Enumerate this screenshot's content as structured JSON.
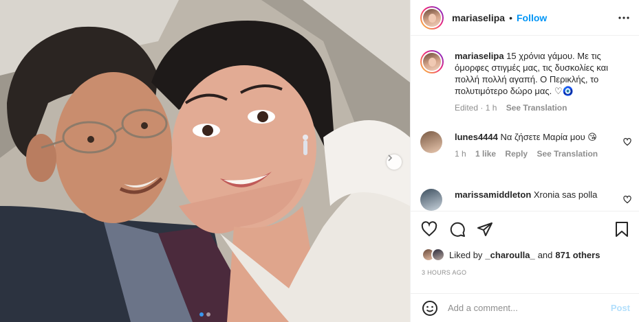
{
  "post": {
    "username": "mariaselipa",
    "separator": "•",
    "follow_label": "Follow",
    "more_icon": "more-horizontal-icon",
    "caption": "15 χρόνια γάμου. Με τις όμορφες στιγμές μας, τις δυσκολίες και πολλή πολλή αγαπή. Ο Περικλής, το πολυτιμότερο δώρο μας. ♡🧿",
    "caption_edited": "Edited",
    "caption_age": "1 h",
    "see_translation": "See Translation"
  },
  "comments": [
    {
      "username": "lunes4444",
      "text": "Να ζήσετε Μαρία μου 😘",
      "age": "1 h",
      "likes": "1 like",
      "reply": "Reply",
      "see_translation": "See Translation"
    },
    {
      "username": "marissamiddleton",
      "text": "Xronia sas polla"
    }
  ],
  "actions": {
    "like_icon": "heart-icon",
    "comment_icon": "comment-icon",
    "share_icon": "send-icon",
    "save_icon": "bookmark-icon"
  },
  "likes": {
    "prefix": "Liked by",
    "user": "_charoulla_",
    "and": "and",
    "others": "871 others"
  },
  "timestamp": "3 HOURS AGO",
  "add_comment": {
    "emoji_icon": "emoji-icon",
    "placeholder": "Add a comment...",
    "post_label": "Post"
  },
  "carousel": {
    "next_icon": "chevron-right-icon",
    "dots": 2,
    "active": 1
  },
  "colors": {
    "link": "#0095f6",
    "muted": "#8e8e8e",
    "post_disabled": "#b2dffc"
  }
}
